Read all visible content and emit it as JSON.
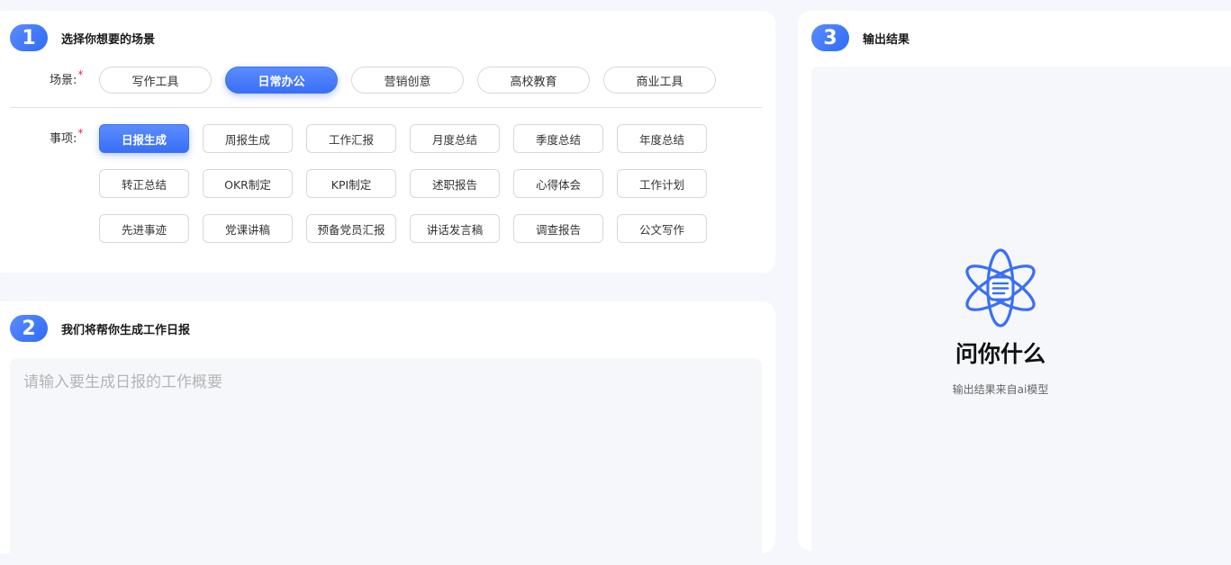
{
  "step1": {
    "number": "1",
    "title": "选择你想要的场景",
    "scene_label": "场景:",
    "item_label": "事项:",
    "required_mark": "*",
    "scenes": [
      "写作工具",
      "日常办公",
      "营销创意",
      "高校教育",
      "商业工具"
    ],
    "active_scene": "日常办公",
    "items": [
      [
        "日报生成",
        "周报生成",
        "工作汇报",
        "月度总结",
        "季度总结",
        "年度总结"
      ],
      [
        "转正总结",
        "OKR制定",
        "KPI制定",
        "述职报告",
        "心得体会",
        "工作计划"
      ],
      [
        "先进事迹",
        "党课讲稿",
        "预备党员汇报",
        "讲话发言稿",
        "调查报告",
        "公文写作"
      ]
    ],
    "active_item": "日报生成"
  },
  "step2": {
    "number": "2",
    "title": "我们将帮你生成工作日报",
    "input_value": "",
    "input_placeholder": "请输入要生成日报的工作概要"
  },
  "step3": {
    "number": "3",
    "title": "输出结果",
    "empty_icon": "atom-chat-icon",
    "empty_title": "问你什么",
    "empty_subtitle": "输出结果来自ai模型"
  },
  "colors": {
    "accent": "#3a6ff7",
    "background": "#f5f7fc",
    "required": "#e8246b"
  }
}
